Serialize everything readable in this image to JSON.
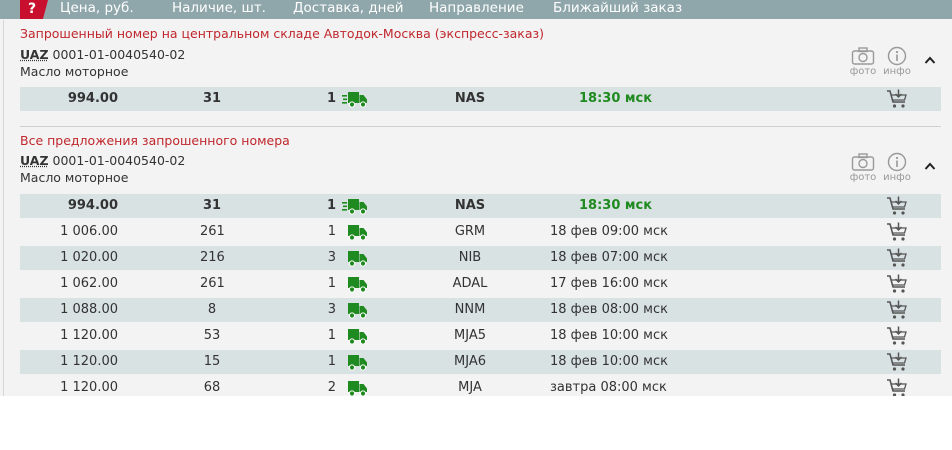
{
  "header": {
    "help_symbol": "?",
    "columns": [
      "Цена, руб.",
      "Наличие, шт.",
      "Доставка, дней",
      "Направление",
      "Ближайший заказ"
    ]
  },
  "requested": {
    "title": "Запрошенный номер на центральном складе Автодок-Москва (экспресс-заказ)",
    "brand": "UAZ",
    "number": "0001-01-0040540-02",
    "description": "Масло моторное",
    "photo_label": "фото",
    "info_label": "инфо",
    "rows": [
      {
        "price": "994.00",
        "qty": "31",
        "days": "1",
        "direction": "NAS",
        "eta": "18:30 мск",
        "express": true
      }
    ]
  },
  "all_offers": {
    "title": "Все предложения запрошенного номера",
    "brand": "UAZ",
    "number": "0001-01-0040540-02",
    "description": "Масло моторное",
    "photo_label": "фото",
    "info_label": "инфо",
    "rows": [
      {
        "price": "994.00",
        "qty": "31",
        "days": "1",
        "direction": "NAS",
        "eta": "18:30 мск",
        "express": true
      },
      {
        "price": "1 006.00",
        "qty": "261",
        "days": "1",
        "direction": "GRM",
        "eta": "18 фев 09:00 мск",
        "express": false
      },
      {
        "price": "1 020.00",
        "qty": "216",
        "days": "3",
        "direction": "NIB",
        "eta": "18 фев 07:00 мск",
        "express": false
      },
      {
        "price": "1 062.00",
        "qty": "261",
        "days": "1",
        "direction": "ADAL",
        "eta": "17 фев 16:00 мск",
        "express": false
      },
      {
        "price": "1 088.00",
        "qty": "8",
        "days": "3",
        "direction": "NNM",
        "eta": "18 фев 08:00 мск",
        "express": false
      },
      {
        "price": "1 120.00",
        "qty": "53",
        "days": "1",
        "direction": "MJA5",
        "eta": "18 фев 10:00 мск",
        "express": false
      },
      {
        "price": "1 120.00",
        "qty": "15",
        "days": "1",
        "direction": "MJA6",
        "eta": "18 фев 10:00 мск",
        "express": false
      },
      {
        "price": "1 120.00",
        "qty": "68",
        "days": "2",
        "direction": "MJA",
        "eta": "завтра 08:00 мск",
        "express": false
      }
    ]
  },
  "colors": {
    "header_bg": "#8fa6aa",
    "accent_red": "#c0272d",
    "row_shade": "#d9e2e3",
    "green": "#1f8a1f"
  }
}
